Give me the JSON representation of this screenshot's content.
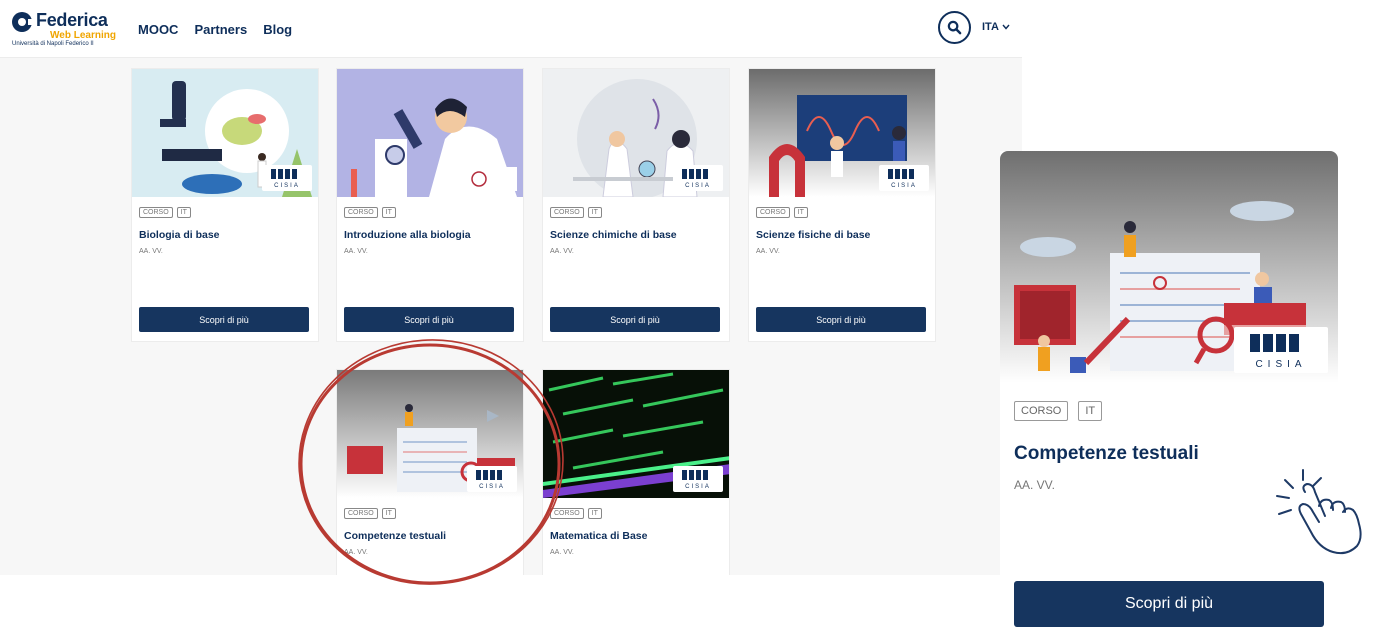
{
  "header": {
    "logo_title": "Federica",
    "logo_sub": "Web Learning",
    "logo_uni": "Università di Napoli Federico II",
    "nav": [
      "MOOC",
      "Partners",
      "Blog"
    ],
    "lang": "ITA"
  },
  "cards": [
    {
      "tag1": "CORSO",
      "tag2": "IT",
      "title": "Biologia di base",
      "author": "AA. VV.",
      "button": "Scopri di più",
      "badge": "CISIA"
    },
    {
      "tag1": "CORSO",
      "tag2": "IT",
      "title": "Introduzione alla biologia",
      "author": "AA. VV.",
      "button": "Scopri di più"
    },
    {
      "tag1": "CORSO",
      "tag2": "IT",
      "title": "Scienze chimiche di base",
      "author": "AA. VV.",
      "button": "Scopri di più",
      "badge": "CISIA"
    },
    {
      "tag1": "CORSO",
      "tag2": "IT",
      "title": "Scienze fisiche di base",
      "author": "AA. VV.",
      "button": "Scopri di più",
      "badge": "CISIA"
    },
    {
      "tag1": "CORSO",
      "tag2": "IT",
      "title": "Competenze testuali",
      "author": "AA. VV.",
      "badge": "CISIA"
    },
    {
      "tag1": "CORSO",
      "tag2": "IT",
      "title": "Matematica di Base",
      "author": "AA. VV.",
      "badge": "CISIA"
    }
  ],
  "featured": {
    "tag1": "CORSO",
    "tag2": "IT",
    "title": "Competenze testuali",
    "author": "AA. VV.",
    "button": "Scopri di più",
    "badge": "CISIA"
  },
  "colors": {
    "brand_navy": "#0e2e5a",
    "button_navy": "#16355f",
    "highlight_circle": "#b83a32",
    "logo_accent": "#f0a500"
  }
}
